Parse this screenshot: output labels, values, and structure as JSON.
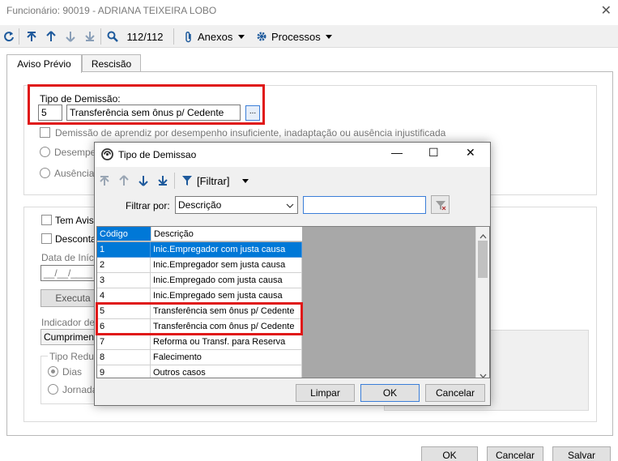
{
  "window": {
    "title": "Funcionário: 90019 - ADRIANA TEIXEIRA LOBO",
    "close_glyph": "✕"
  },
  "toolbar": {
    "record_counter": "112/112",
    "anexos_label": "Anexos",
    "processos_label": "Processos"
  },
  "tabs": [
    {
      "label": "Aviso Prévio",
      "active": true
    },
    {
      "label": "Rescisão",
      "active": false
    }
  ],
  "form": {
    "tipo_demissao_label": "Tipo de Demissão:",
    "tipo_demissao_code": "5",
    "tipo_demissao_desc": "Transferência sem ônus p/ Cedente",
    "lookup_button": "...",
    "aprendiz_checkbox": "Demissão de aprendiz por desempenho insuficiente, inadaptação ou ausência injustificada",
    "radio_desempenho": "Desempen",
    "radio_ausencia": "Ausência i",
    "tem_aviso": "Tem Aviso",
    "desconta": "Desconta",
    "data_inicio_label": "Data de Início",
    "data_inicio_value": "__/__/____",
    "executa_button": "Executa",
    "indicador_label": "Indicador de C",
    "indicador_value": "Cumprimento",
    "tipo_reducao_label": "Tipo Reduçã",
    "radio_dias": "Dias",
    "radio_jornada": "Jornada"
  },
  "footer": {
    "ok": "OK",
    "cancelar": "Cancelar",
    "salvar": "Salvar"
  },
  "dialog": {
    "title": "Tipo de Demissao",
    "minimize": "—",
    "maximize": "☐",
    "close": "✕",
    "filter_menu_label": "[Filtrar]",
    "filtrar_por_label": "Filtrar por:",
    "filtrar_por_value": "Descrição",
    "filter_text": "",
    "columns": {
      "codigo": "Código",
      "descricao": "Descrição"
    },
    "rows": [
      {
        "code": "1",
        "desc": "Inic.Empregador com justa causa",
        "selected": true
      },
      {
        "code": "2",
        "desc": "Inic.Empregador sem justa causa",
        "selected": false
      },
      {
        "code": "3",
        "desc": "Inic.Empregado com justa causa",
        "selected": false
      },
      {
        "code": "4",
        "desc": "Inic.Empregado sem justa causa",
        "selected": false
      },
      {
        "code": "5",
        "desc": "Transferência sem ônus p/ Cedente",
        "selected": false
      },
      {
        "code": "6",
        "desc": "Transferência com ônus p/ Cedente",
        "selected": false
      },
      {
        "code": "7",
        "desc": "Reforma ou Transf. para Reserva",
        "selected": false
      },
      {
        "code": "8",
        "desc": "Falecimento",
        "selected": false
      },
      {
        "code": "9",
        "desc": "Outros casos",
        "selected": false
      }
    ],
    "buttons": {
      "limpar": "Limpar",
      "ok": "OK",
      "cancelar": "Cancelar"
    }
  },
  "colors": {
    "accent": "#1e5a9c",
    "highlight_red": "#e01818",
    "selection": "#0078d7"
  }
}
